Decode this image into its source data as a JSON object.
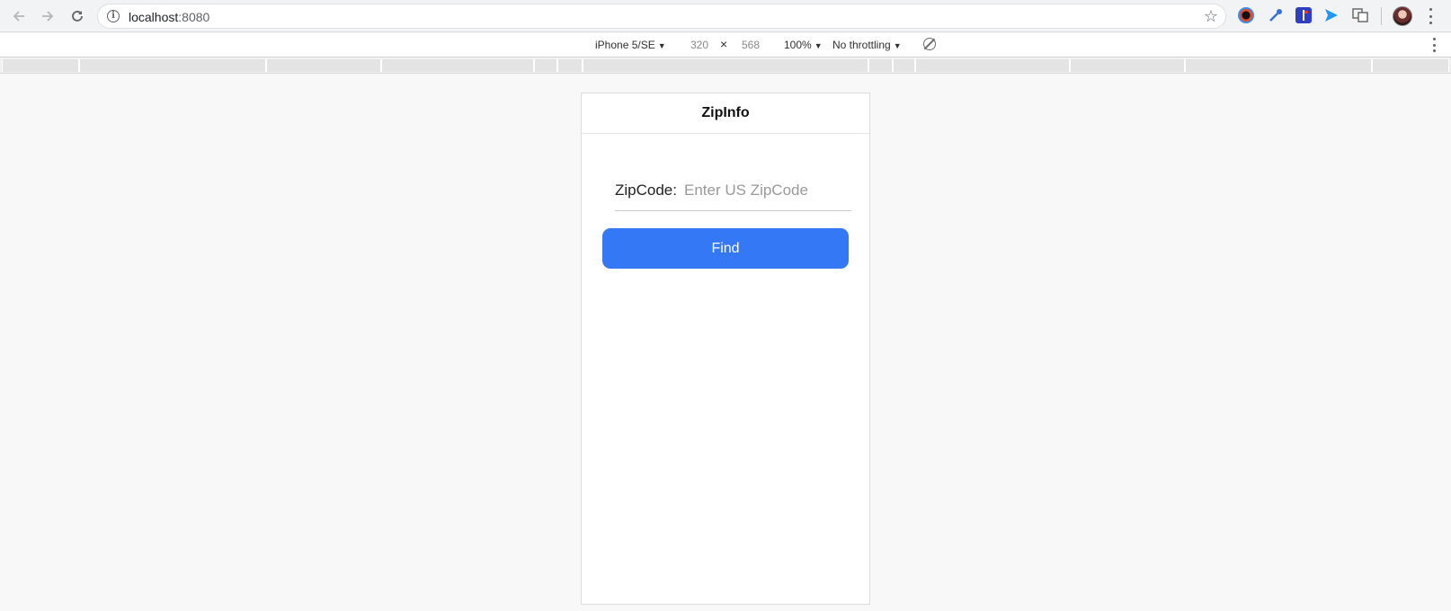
{
  "browser": {
    "url_host": "localhost",
    "url_port": ":8080",
    "icons": {
      "back": "arrow-left-icon",
      "forward": "arrow-right-icon",
      "reload": "reload-icon",
      "info": "info-icon",
      "bookmark": "star-icon"
    },
    "extensions": [
      "color-wheel-icon",
      "eyedropper-icon",
      "flag-icon",
      "send-icon",
      "translate-icon"
    ]
  },
  "device_toolbar": {
    "device": "iPhone 5/SE",
    "width": "320",
    "times": "×",
    "height": "568",
    "zoom": "100%",
    "throttling": "No throttling"
  },
  "app": {
    "title": "ZipInfo",
    "zip_label": "ZipCode:",
    "zip_placeholder": "Enter US ZipCode",
    "zip_value": "",
    "find_label": "Find",
    "accent_color": "#3478f6"
  }
}
